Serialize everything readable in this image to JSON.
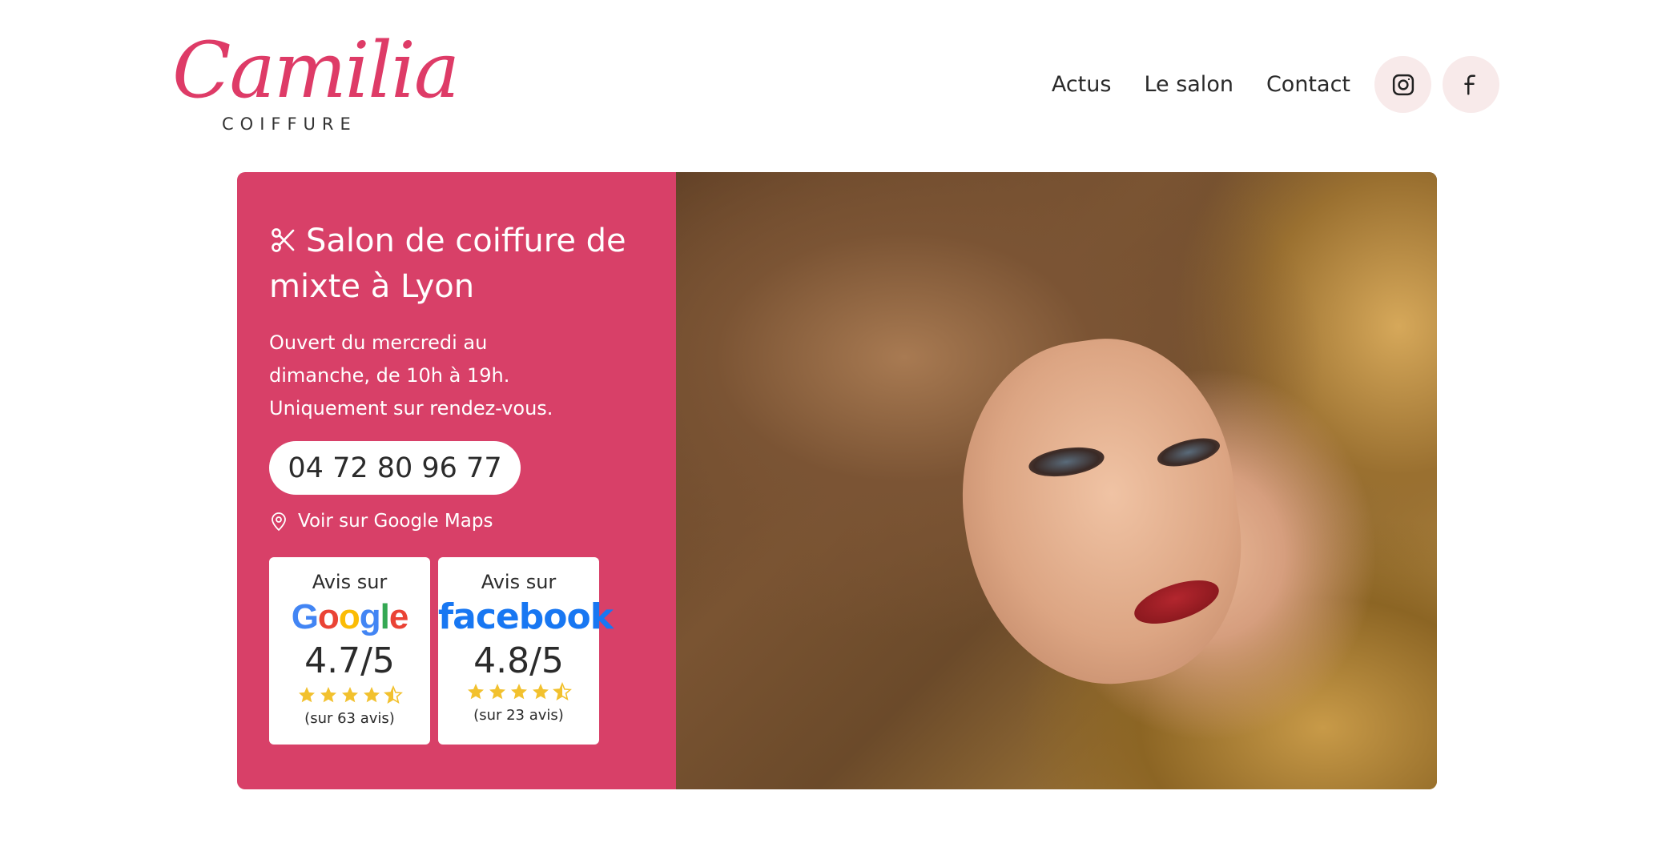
{
  "brand": {
    "name": "Camilia",
    "sub": "COIFFURE"
  },
  "nav": {
    "links": [
      "Actus",
      "Le salon",
      "Contact"
    ],
    "icons": [
      "instagram-icon",
      "facebook-icon"
    ]
  },
  "hero": {
    "title": "Salon de coiffure de mixte à Lyon",
    "hours": [
      "Ouvert du mercredi au",
      "dimanche, de 10h à 19h.",
      "Uniquement sur rendez-vous."
    ],
    "phone": "04 72 80 96 77",
    "maps_label": "Voir sur Google Maps",
    "reviews": [
      {
        "label": "Avis sur",
        "brand": "Google",
        "score": "4.7/5",
        "rating": 4.5,
        "count": "(sur 63 avis)"
      },
      {
        "label": "Avis sur",
        "brand": "facebook",
        "score": "4.8/5",
        "rating": 4.5,
        "count": "(sur 23 avis)"
      }
    ]
  },
  "colors": {
    "accent": "#d84068",
    "logo": "#de3b67",
    "star": "#f2c12e",
    "social_bg": "#f8eaea"
  }
}
